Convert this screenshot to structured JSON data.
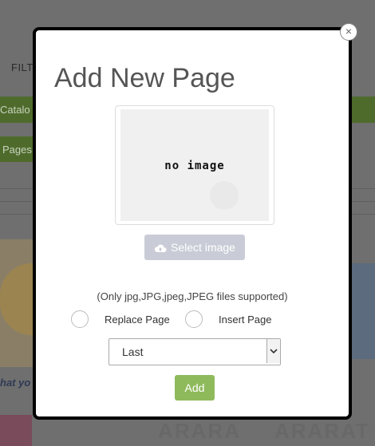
{
  "background": {
    "filters_label": "FILT",
    "catalog_tab": "Catalo",
    "pages_tab": "Pages",
    "partial_text": "hat yo",
    "brand_left": "ARARA",
    "brand_right": "ARARAT"
  },
  "modal": {
    "title": "Add New Page",
    "close_glyph": "×",
    "image": {
      "placeholder_text": "no image"
    },
    "select_image_label": "Select image",
    "supported_note": "(Only jpg,JPG,jpeg,JPEG files supported)",
    "radio_options": [
      "Replace Page",
      "Insert Page"
    ],
    "position_select": {
      "selected": "Last"
    },
    "add_label": "Add"
  },
  "colors": {
    "add_button": "#8fba5c",
    "select_button": "#c9ccd6",
    "background_green": "#4f6b2c"
  },
  "icons": {
    "select_image": "cloud-upload-icon",
    "close": "close-icon",
    "dropdown": "chevron-down-icon"
  }
}
